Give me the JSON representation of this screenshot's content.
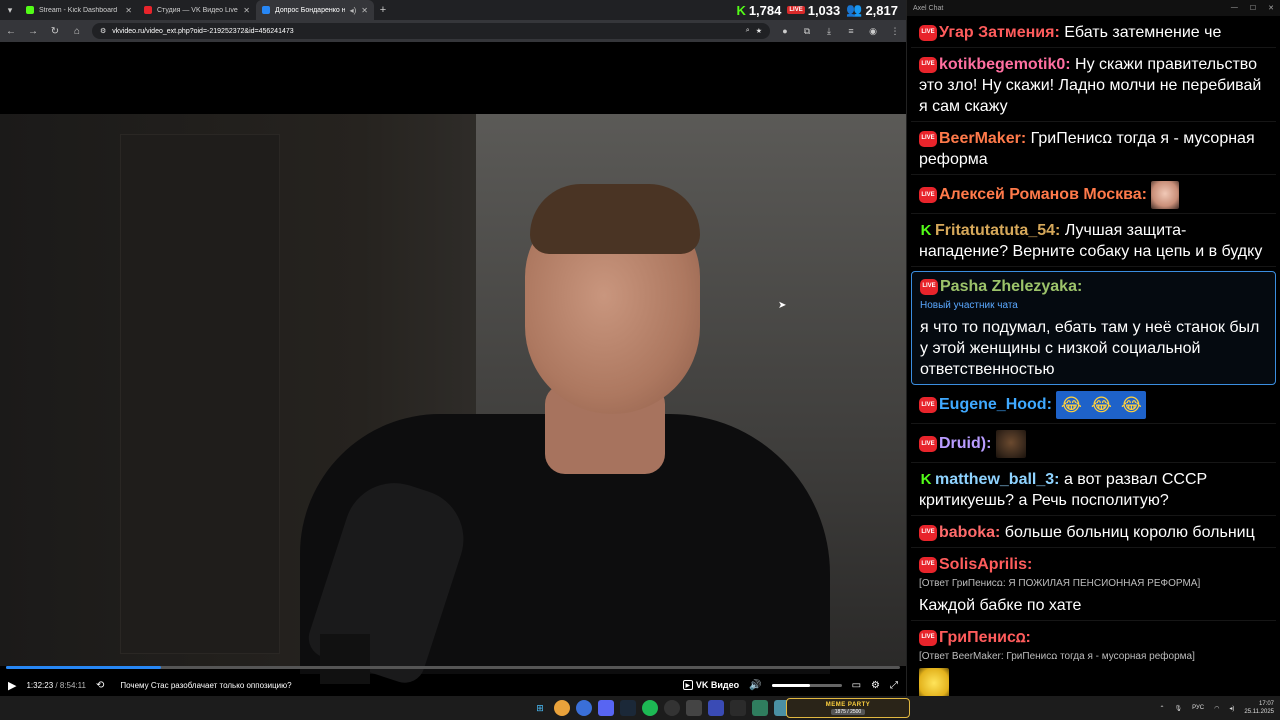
{
  "browser": {
    "tabs": [
      {
        "title": "Stream - Kick Dashboard",
        "favicon_color": "#53fc18"
      },
      {
        "title": "Студия — VK Видео Live",
        "favicon_color": "#e8242b"
      },
      {
        "title": "Допрос Бондаренко нар",
        "favicon_color": "#2787f5",
        "active": true
      }
    ],
    "new_tab_symbol": "+",
    "url": "vkvideo.ru/video_ext.php?oid=-219252372&id=456241473"
  },
  "stats": {
    "kick_viewers": "1,784",
    "vk_viewers": "1,033",
    "total_viewers": "2,817",
    "vk_badge": "LIVE"
  },
  "player": {
    "time_current": "1:32:23",
    "time_separator": "/",
    "time_total": "8:54:11",
    "progress_fraction": 0.173,
    "volume_fraction": 0.55,
    "video_title": "Почему Стас разоблачает только оппозицию?",
    "brand_label": "VK Видео"
  },
  "chat": {
    "window_title": "Axel Chat",
    "messages": [
      {
        "platform": "vk",
        "user": "Угар Затмения:",
        "color": "#ff5c5c",
        "text": "Ебать затемнение че"
      },
      {
        "platform": "vk",
        "user": "kotikbegemotik0:",
        "color": "#ff6fa0",
        "text": "Ну скажи правительство это зло! Ну скажи! Ладно молчи не перебивай я сам скажу"
      },
      {
        "platform": "vk",
        "user": "BeerMaker:",
        "color": "#ff7a4a",
        "text": "ГриПенисꭥ тогда я - мусорная реформа"
      },
      {
        "platform": "vk",
        "user": "Алексей Романов Москва:",
        "color": "#ff7a4a",
        "text": "",
        "emote": "face"
      },
      {
        "platform": "kick",
        "user": "Fritatutatuta_54:",
        "color": "#d6a85a",
        "text": "Лучшая защита-нападение? Верните собаку на цепь и в будку"
      },
      {
        "platform": "vk",
        "user": "Pasha Zhelezyaka:",
        "color": "#9cc36a",
        "text": "я что то подумал, ебать там у неё станок был у этой женщины с низкой социальной ответственностью",
        "note": "Новый участник чата",
        "highlight": true
      },
      {
        "platform": "vk",
        "user": "Eugene_Hood:",
        "color": "#3fa9ff",
        "text": "",
        "emote": "laugh"
      },
      {
        "platform": "vk",
        "user": "Druid):",
        "color": "#b99cff",
        "text": "",
        "emote": "druid"
      },
      {
        "platform": "kick",
        "user": "matthew_ball_3:",
        "color": "#8fd3ff",
        "text": "а вот развал СССР критикуешь? а Речь посполитую?"
      },
      {
        "platform": "vk",
        "user": "baboka:",
        "color": "#ff6b6b",
        "text": "больше больниц королю больниц"
      },
      {
        "platform": "vk",
        "user": "SolisAprilis:",
        "color": "#ff5c5c",
        "text": "Каждой бабке по хате",
        "reply": "[Ответ ГриПенисꭥ: Я ПОЖИЛАЯ ПЕНСИОННАЯ РЕФОРМА]"
      },
      {
        "platform": "vk",
        "user": "ГриПенисꭥ:",
        "color": "#ff5c5c",
        "text": "",
        "reply": "[Ответ BeerMaker: ГриПенисꭥ тогда я - мусорная реформа]",
        "emote": "yellow"
      }
    ]
  },
  "taskbar": {
    "meme_title": "MEME PARTY",
    "meme_progress": "1875 / 2500",
    "lang": "РУС",
    "time": "17:07",
    "date": "25.11.2025"
  }
}
